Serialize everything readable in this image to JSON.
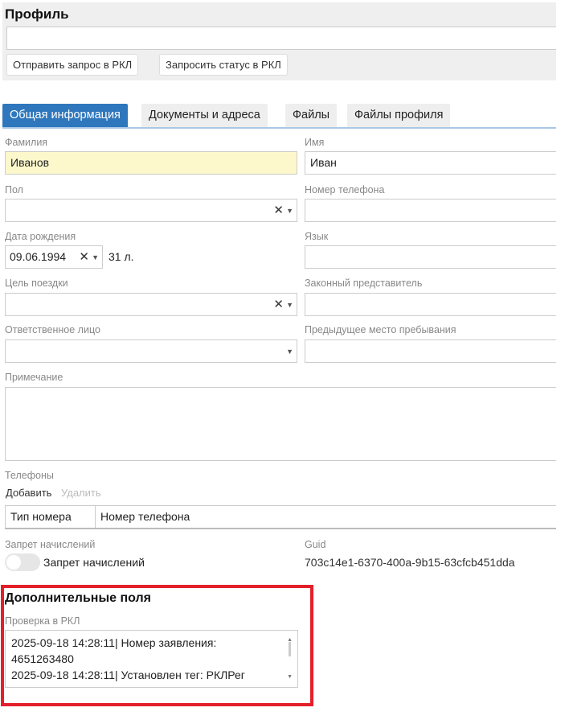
{
  "header": {
    "title": "Профиль",
    "input_value": "",
    "buttons": [
      "Отправить запрос в РКЛ",
      "Запросить статус в РКЛ"
    ]
  },
  "tabs": [
    {
      "label": "Общая информация",
      "active": true
    },
    {
      "label": "Документы и адреса"
    },
    {
      "label": "Файлы"
    },
    {
      "label": "Файлы профиля"
    }
  ],
  "colors": {
    "accent": "#2f77bd",
    "highlight": "#e3202a"
  },
  "form": {
    "last_name": {
      "label": "Фамилия",
      "value": "Иванов"
    },
    "first_name": {
      "label": "Имя",
      "value": "Иван"
    },
    "gender": {
      "label": "Пол",
      "value": ""
    },
    "phone": {
      "label": "Номер телефона",
      "value": ""
    },
    "birth_date": {
      "label": "Дата рождения",
      "value": "09.06.1994",
      "age": "31 л."
    },
    "language": {
      "label": "Язык",
      "value": ""
    },
    "trip_purpose": {
      "label": "Цель поездки",
      "value": ""
    },
    "legal_rep": {
      "label": "Законный представитель",
      "value": ""
    },
    "responsible": {
      "label": "Ответственное лицо",
      "value": ""
    },
    "prev_place": {
      "label": "Предыдущее место пребывания",
      "value": ""
    },
    "note": {
      "label": "Примечание",
      "value": ""
    }
  },
  "phones": {
    "label": "Телефоны",
    "add": "Добавить",
    "delete": "Удалить",
    "columns": [
      "Тип номера",
      "Номер телефона"
    ]
  },
  "charges_ban": {
    "label": "Запрет начислений",
    "toggle_label": "Запрет начислений",
    "on": false
  },
  "guid": {
    "label": "Guid",
    "value": "703c14e1-6370-400a-9b15-63cfcb451dda"
  },
  "extra": {
    "title": "Дополнительные поля",
    "rkl_label": "Проверка в РКЛ",
    "lines": [
      "2025-09-18 14:28:11| Номер заявления:",
      "4651263480",
      "2025-09-18 14:28:11| Установлен тег: РКЛРег"
    ]
  }
}
